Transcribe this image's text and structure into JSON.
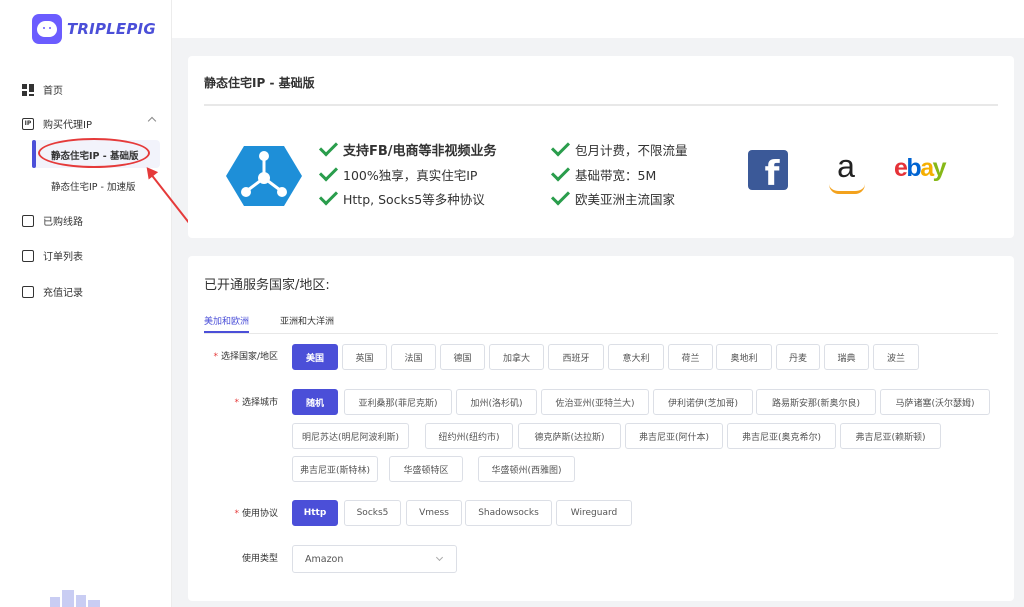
{
  "brand": {
    "name": "TRIPLEPIG",
    "color": "#4b4fd8"
  },
  "sidebar": {
    "home": "首页",
    "buy_proxy": "购买代理IP",
    "sub_items": [
      "静态住宅IP - 基础版",
      "静态住宅IP - 加速版"
    ],
    "purchased": "已购线路",
    "orders": "订单列表",
    "recharge": "充值记录"
  },
  "product": {
    "title": "静态住宅IP - 基础版",
    "features_left": [
      "支持FB/电商等非视频业务",
      "100%独享，真实住宅IP",
      "Http, Socks5等多种协议"
    ],
    "features_right": [
      "包月计费，不限流量",
      "基础带宽：5M",
      "欧美亚洲主流国家"
    ],
    "logos": [
      "facebook-logo",
      "amazon-logo",
      "ebay-logo"
    ]
  },
  "service": {
    "title": "已开通服务国家/地区:",
    "tabs": [
      "美加和欧洲",
      "亚洲和大洋洲"
    ],
    "country_label": "选择国家/地区",
    "countries": [
      "美国",
      "英国",
      "法国",
      "德国",
      "加拿大",
      "西班牙",
      "意大利",
      "荷兰",
      "奥地利",
      "丹麦",
      "瑞典",
      "波兰"
    ],
    "selected_country": "美国",
    "city_label": "选择城市",
    "cities": [
      "随机",
      "亚利桑那(菲尼克斯)",
      "加州(洛杉矶)",
      "佐治亚州(亚特兰大)",
      "伊利诺伊(芝加哥)",
      "路易斯安那(新奥尔良)",
      "马萨诸塞(沃尔瑟姆)",
      "明尼苏达(明尼阿波利斯)",
      "纽约州(纽约市)",
      "德克萨斯(达拉斯)",
      "弗吉尼亚(阿什本)",
      "弗吉尼亚(奥克希尔)",
      "弗吉尼亚(赖斯顿)",
      "弗吉尼亚(斯特林)",
      "华盛顿特区",
      "华盛顿州(西雅图)"
    ],
    "selected_city": "随机",
    "protocol_label": "使用协议",
    "protocols": [
      "Http",
      "Socks5",
      "Vmess",
      "Shadowsocks",
      "Wireguard"
    ],
    "selected_protocol": "Http",
    "usage_label": "使用类型",
    "usage_value": "Amazon",
    "required_mark": "*"
  }
}
